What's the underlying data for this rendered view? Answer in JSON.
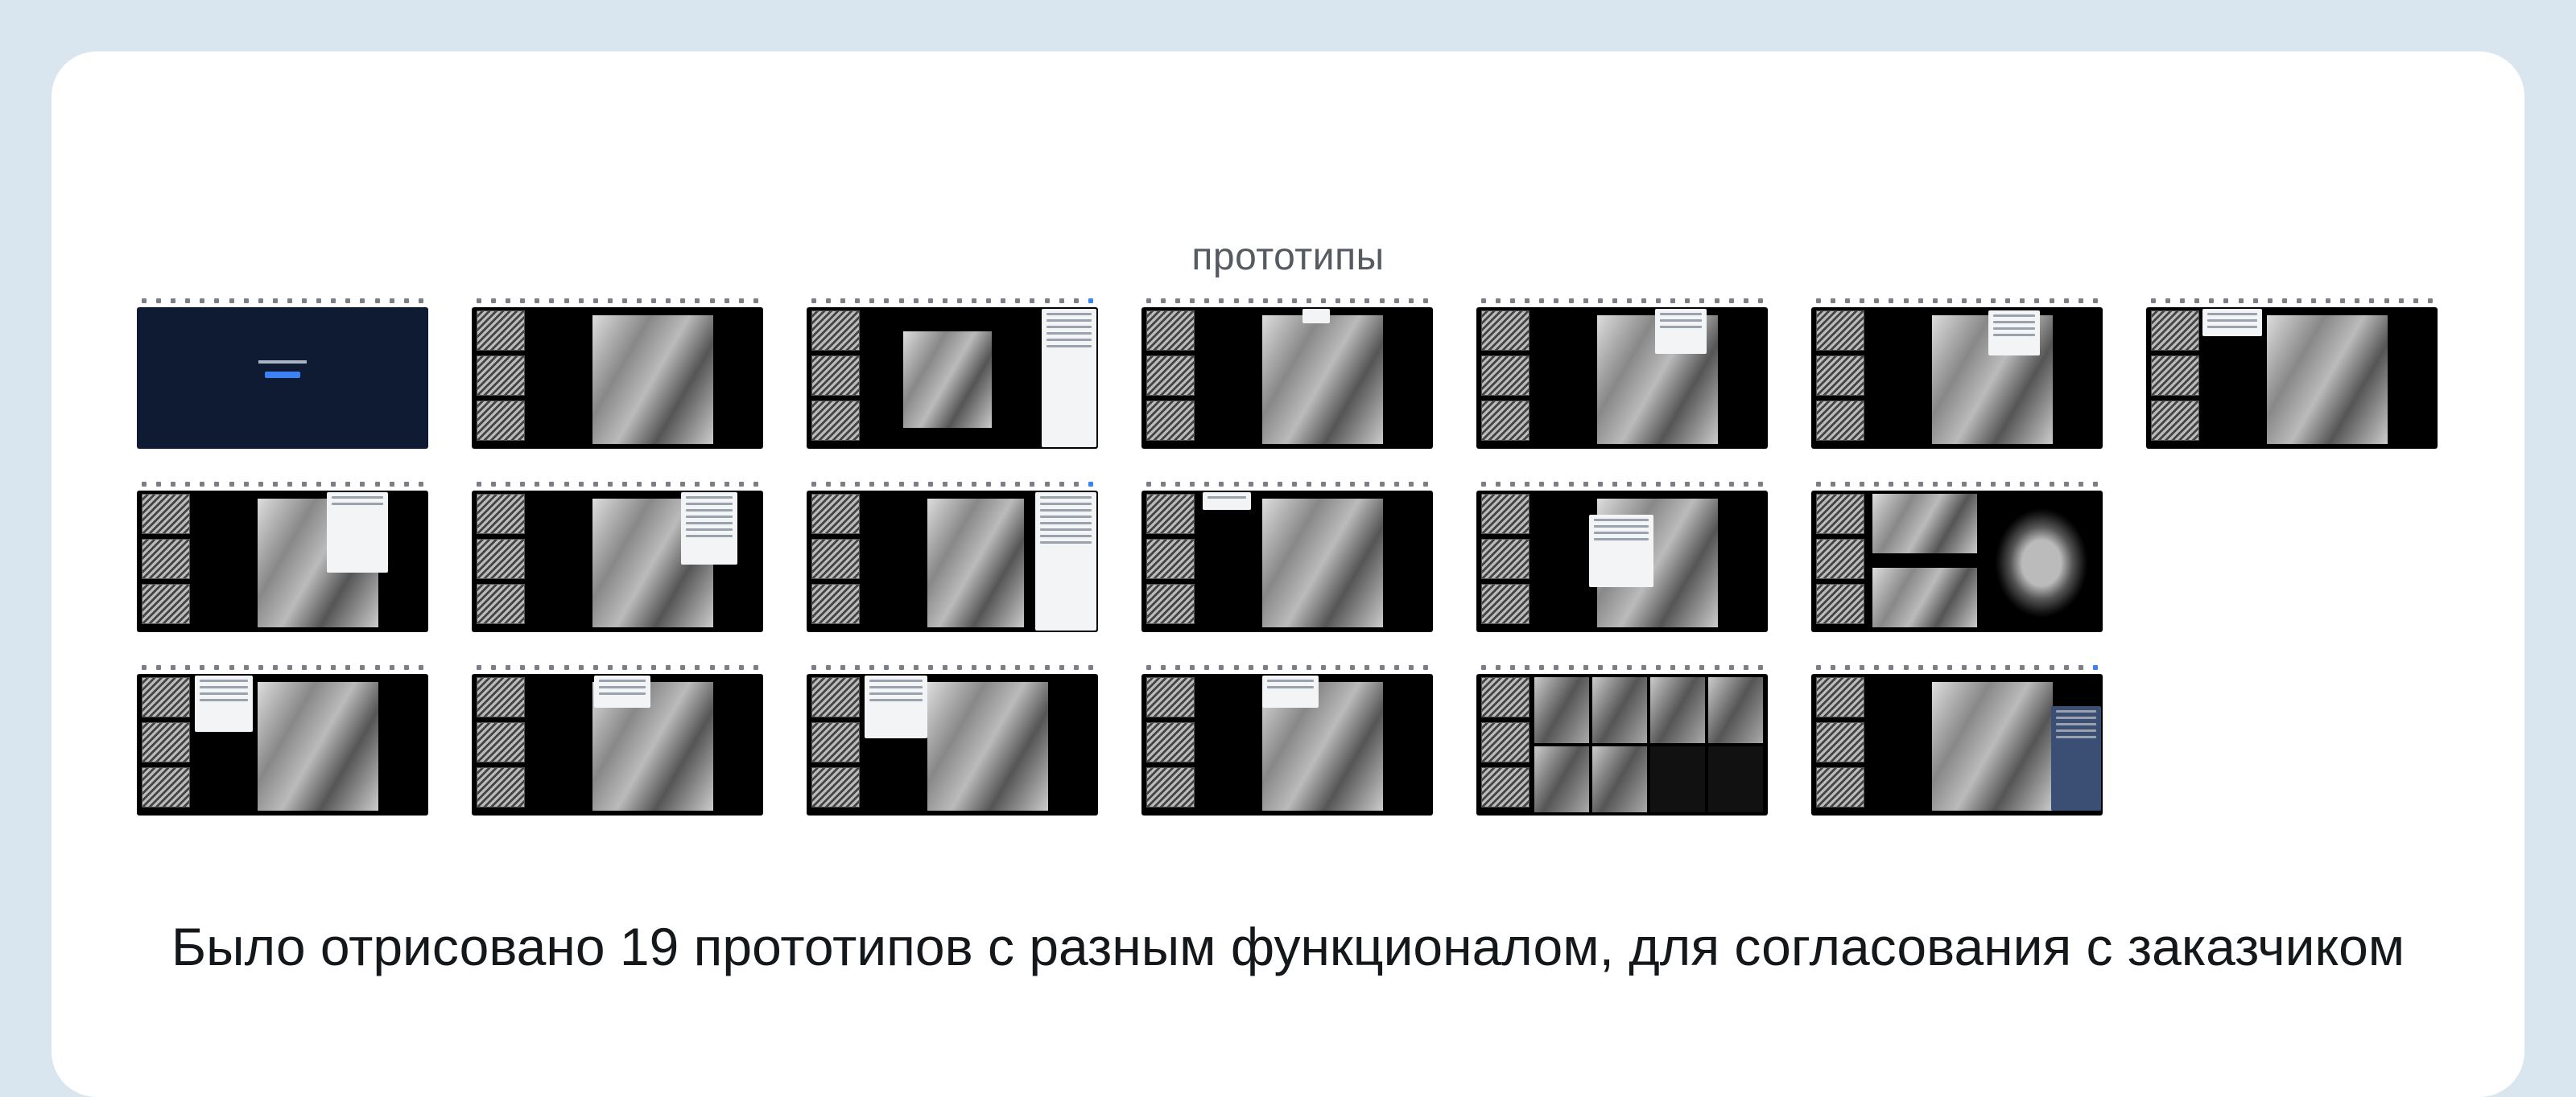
{
  "section_title": "прототипы",
  "caption": "Было отрисовано 19 прототипов с разным функционалом, для согласования с заказчиком",
  "colors": {
    "page_bg": "#dae6ef",
    "card_bg": "#ffffff",
    "accent": "#3b82f6",
    "viewer_bg": "#000000",
    "start_screen_bg": "#0f1a33"
  },
  "prototypes": [
    {
      "variant": "start-screen"
    },
    {
      "variant": "viewer"
    },
    {
      "variant": "viewer-settings-panel"
    },
    {
      "variant": "viewer-layout-popup"
    },
    {
      "variant": "viewer-menu-popup"
    },
    {
      "variant": "viewer-dialog"
    },
    {
      "variant": "viewer-list-popup"
    },
    {
      "variant": "viewer-diagram-panel"
    },
    {
      "variant": "viewer-options-list"
    },
    {
      "variant": "viewer-side-panel"
    },
    {
      "variant": "viewer-info-popup"
    },
    {
      "variant": "viewer-form-dialog"
    },
    {
      "variant": "ct-mpr-view"
    },
    {
      "variant": "viewer-checkbox-popup"
    },
    {
      "variant": "viewer-note-popup"
    },
    {
      "variant": "viewer-color-popup"
    },
    {
      "variant": "viewer-tooltip-popup"
    },
    {
      "variant": "multi-series-grid"
    },
    {
      "variant": "viewer-right-panel"
    }
  ]
}
